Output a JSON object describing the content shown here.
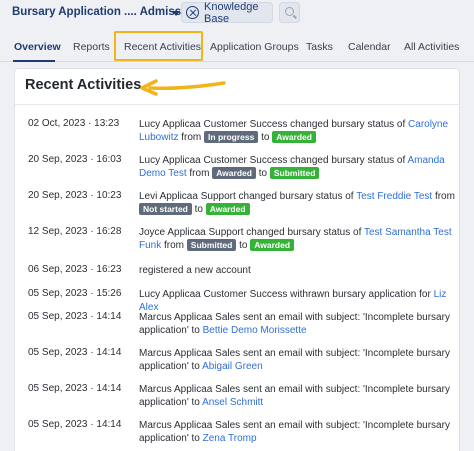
{
  "header": {
    "app_title": "Bursary Application .... Admission...",
    "knowledge_base_label": "Knowledge Base"
  },
  "tabs": [
    {
      "label": "Overview",
      "active": true
    },
    {
      "label": "Reports"
    },
    {
      "label": "Recent Activities"
    },
    {
      "label": "Application Groups"
    },
    {
      "label": "Tasks"
    },
    {
      "label": "Calendar"
    },
    {
      "label": "All Activities"
    }
  ],
  "card": {
    "title": "Recent Activities"
  },
  "colors": {
    "accent": "#1f3b73",
    "link": "#2f6fd6",
    "highlight": "#f2b41b",
    "badge_gray": "#5f6b7b",
    "badge_green": "#35b338"
  },
  "activities": [
    {
      "date": "02 Oct, 2023 · 13:23",
      "text": "Lucy Applicaa Customer Success changed bursary status of",
      "link": "Carolyne Lubowitz",
      "from_word": "from",
      "from_badge": "In progress",
      "to_word": "to",
      "to_badge": "Awarded"
    },
    {
      "date": "20 Sep, 2023 · 16:03",
      "text": "Lucy Applicaa Customer Success changed bursary status of",
      "link": "Amanda Demo Test",
      "from_word": "from",
      "from_badge": "Awarded",
      "to_word": "to",
      "to_badge": "Submitted"
    },
    {
      "date": "20 Sep, 2023 · 10:23",
      "text": "Levi Applicaa Support changed bursary status of",
      "link": "Test Freddie Test",
      "from_word": "from",
      "from_badge": "Not started",
      "to_word": "to",
      "to_badge": "Awarded"
    },
    {
      "date": "12 Sep, 2023 · 16:28",
      "text": "Joyce Applicaa Support changed bursary status of",
      "link": "Test Samantha Test Funk",
      "from_word": "from",
      "from_badge": "Submitted",
      "to_word": "to",
      "to_badge": "Awarded"
    },
    {
      "date": "06 Sep, 2023 · 16:23",
      "text": "registered a new account"
    },
    {
      "date": "05 Sep, 2023 · 15:26",
      "text": "Lucy Applicaa Customer Success withrawn bursary application for",
      "link": "Liz Alex"
    },
    {
      "date": "05 Sep, 2023 · 14:14",
      "text": "Marcus Applicaa Sales sent an email with subject: 'Incomplete bursary application' to",
      "link": "Bettie Demo Morissette"
    },
    {
      "date": "05 Sep, 2023 · 14:14",
      "text": "Marcus Applicaa Sales sent an email with subject: 'Incomplete bursary application' to",
      "link": "Abigail Green"
    },
    {
      "date": "05 Sep, 2023 · 14:14",
      "text": "Marcus Applicaa Sales sent an email with subject: 'Incomplete bursary application' to",
      "link": "Ansel Schmitt"
    },
    {
      "date": "05 Sep, 2023 · 14:14",
      "text": "Marcus Applicaa Sales sent an email with subject: 'Incomplete bursary application' to",
      "link": "Zena Tromp"
    }
  ]
}
